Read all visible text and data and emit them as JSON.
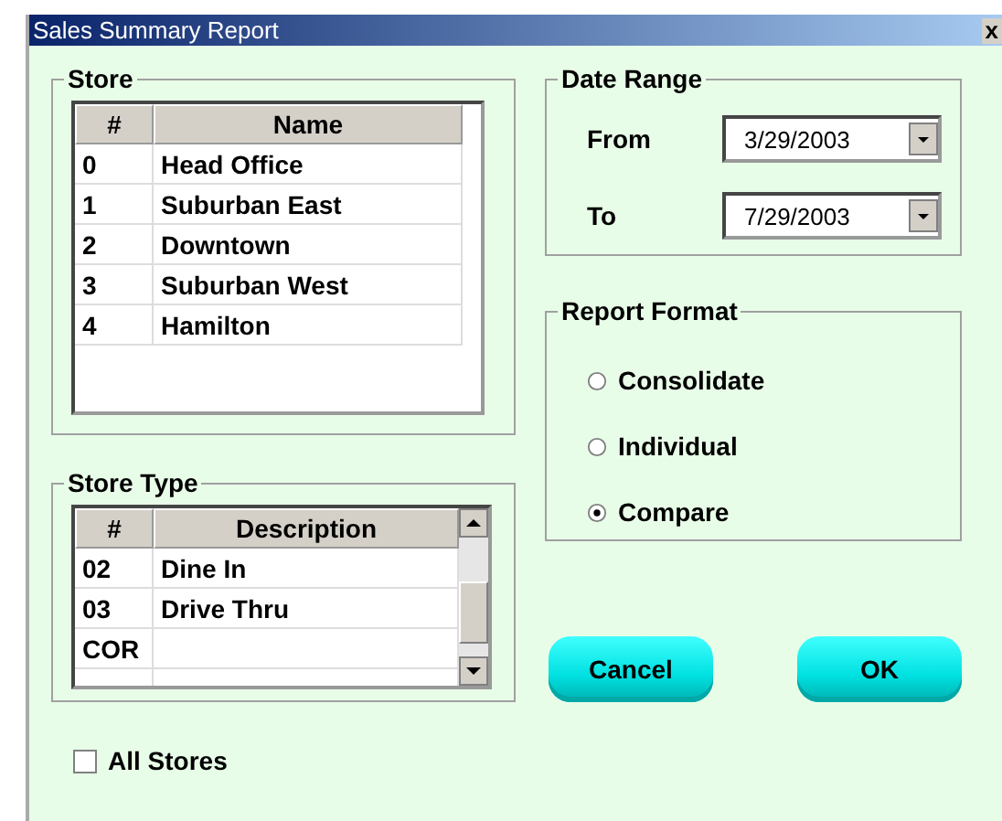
{
  "window": {
    "title": "Sales Summary Report",
    "close": "x"
  },
  "store": {
    "title": "Store",
    "columns": [
      "#",
      "Name"
    ],
    "rows": [
      {
        "id": "0",
        "name": "Head Office"
      },
      {
        "id": "1",
        "name": "Suburban East"
      },
      {
        "id": "2",
        "name": "Downtown"
      },
      {
        "id": "3",
        "name": "Suburban West"
      },
      {
        "id": "4",
        "name": "Hamilton"
      }
    ]
  },
  "store_type": {
    "title": "Store Type",
    "columns": [
      "#",
      "Description"
    ],
    "rows": [
      {
        "id": "02",
        "description": "Dine In"
      },
      {
        "id": "03",
        "description": "Drive Thru"
      },
      {
        "id": "COR",
        "description": ""
      }
    ]
  },
  "date_range": {
    "title": "Date Range",
    "from_label": "From",
    "from": "3/29/2003",
    "to_label": "To",
    "to": "7/29/2003"
  },
  "report_format": {
    "title": "Report Format",
    "options": [
      {
        "label": "Consolidate",
        "selected": false
      },
      {
        "label": "Individual",
        "selected": false
      },
      {
        "label": "Compare",
        "selected": true
      }
    ]
  },
  "buttons": [
    "Cancel",
    "OK"
  ],
  "all_stores": {
    "label": "All Stores",
    "checked": false
  }
}
